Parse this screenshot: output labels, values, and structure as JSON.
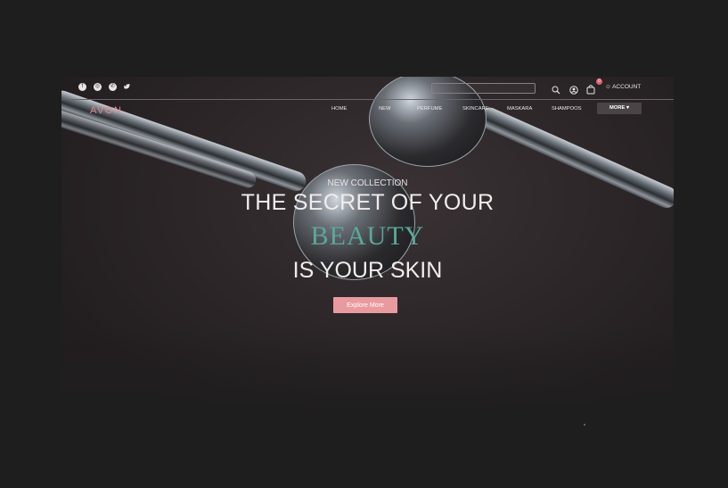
{
  "topbar": {
    "social": [
      {
        "name": "facebook-icon",
        "glyph": "f"
      },
      {
        "name": "instagram-icon",
        "glyph": "◎"
      },
      {
        "name": "whatsapp-icon",
        "glyph": "✆"
      },
      {
        "name": "twitter-icon",
        "glyph": "🐦"
      }
    ],
    "search_placeholder": "",
    "cart_count": "0",
    "account_label": "ACCOUNT"
  },
  "nav": {
    "logo": "AVON",
    "items": [
      "HOME",
      "NEW",
      "PERFUME",
      "SKINCARE",
      "MASKARA",
      "SHAMPOOS"
    ],
    "more_label": "MORE ▾"
  },
  "hero": {
    "eyebrow": "NEW COLLECTION",
    "line1": "THE SECRET OF YOUR",
    "highlight": "BEAUTY",
    "line2": "IS YOUR SKIN",
    "cta_label": "Explore More"
  },
  "colors": {
    "page_bg": "#1e1e1e",
    "accent_pink": "#e99a9e",
    "accent_teal": "#5aa89a",
    "logo": "#e08a8f",
    "badge": "#e0606a"
  }
}
